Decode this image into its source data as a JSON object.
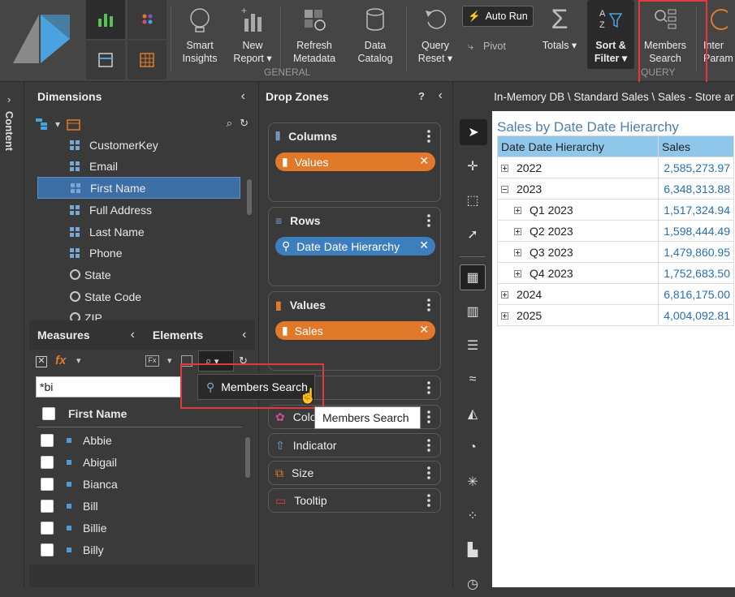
{
  "ribbon": {
    "buttons": [
      {
        "label": "Smart Insights",
        "line1": "Smart",
        "line2": "Insights"
      },
      {
        "label": "New Report",
        "line1": "New",
        "line2": "Report ▾"
      },
      {
        "label": "Refresh Metadata",
        "line1": "Refresh",
        "line2": "Metadata"
      },
      {
        "label": "Data Catalog",
        "line1": "Data",
        "line2": "Catalog"
      },
      {
        "label": "Query Reset",
        "line1": "Query",
        "line2": "Reset ▾"
      },
      {
        "label": "Auto Run"
      },
      {
        "label": "Pivot"
      },
      {
        "label": "Totals ▾"
      },
      {
        "label": "Sort & Filter",
        "line1": "Sort &",
        "line2": "Filter ▾"
      },
      {
        "label": "Members Search",
        "line1": "Members",
        "line2": "Search"
      },
      {
        "label": "Inter Param",
        "line1": "Inter",
        "line2": "Param"
      }
    ],
    "group_general": "GENERAL",
    "group_query": "QUERY"
  },
  "side_tab": "Content",
  "dimensions": {
    "title": "Dimensions",
    "items": [
      {
        "label": "CustomerKey",
        "icon": "grid-icon"
      },
      {
        "label": "Email",
        "icon": "grid-icon"
      },
      {
        "label": "First Name",
        "icon": "grid-icon",
        "selected": true
      },
      {
        "label": "Full Address",
        "icon": "grid-icon"
      },
      {
        "label": "Last Name",
        "icon": "grid-icon"
      },
      {
        "label": "Phone",
        "icon": "grid-icon"
      },
      {
        "label": "State",
        "icon": "globe-icon"
      },
      {
        "label": "State Code",
        "icon": "globe-icon"
      },
      {
        "label": "ZIP",
        "icon": "globe-icon"
      }
    ]
  },
  "bottom_tabs": {
    "measures": "Measures",
    "elements": "Elements"
  },
  "search": {
    "value": "*bi"
  },
  "members": {
    "header": "First Name",
    "items": [
      "Abbie",
      "Abigail",
      "Bianca",
      "Bill",
      "Billie",
      "Billy"
    ]
  },
  "popup": {
    "menu_item": "Members Search",
    "tooltip": "Members Search"
  },
  "drop_zones": {
    "title": "Drop Zones",
    "help": "?",
    "columns": {
      "label": "Columns",
      "pill": "Values"
    },
    "rows": {
      "label": "Rows",
      "pill": "Date Date Hierarchy"
    },
    "values": {
      "label": "Values",
      "pill": "Sales"
    },
    "extra": [
      {
        "label": "Color",
        "visible": "Colo"
      },
      {
        "label": "Indicator"
      },
      {
        "label": "Size"
      },
      {
        "label": "Tooltip"
      }
    ]
  },
  "breadcrumb": "In-Memory DB \\ Standard Sales \\ Sales - Store ar",
  "report": {
    "title": "Sales by Date Date Hierarchy",
    "col_headers": [
      "Date Date Hierarchy",
      "Sales"
    ],
    "rows": [
      {
        "label": "2022",
        "value": "2,585,273.97",
        "level": 0,
        "expanded": false
      },
      {
        "label": "2023",
        "value": "6,348,313.88",
        "level": 0,
        "expanded": true
      },
      {
        "label": "Q1 2023",
        "value": "1,517,324.94",
        "level": 1,
        "expanded": false
      },
      {
        "label": "Q2 2023",
        "value": "1,598,444.49",
        "level": 1,
        "expanded": false
      },
      {
        "label": "Q3 2023",
        "value": "1,479,860.95",
        "level": 1,
        "expanded": false
      },
      {
        "label": "Q4 2023",
        "value": "1,752,683.50",
        "level": 1,
        "expanded": false
      },
      {
        "label": "2024",
        "value": "6,816,175.00",
        "level": 0,
        "expanded": false
      },
      {
        "label": "2025",
        "value": "4,004,092.81",
        "level": 0,
        "expanded": false
      }
    ]
  },
  "colors": {
    "accent_red": "#e0393e",
    "pill_orange": "#e07a2a",
    "pill_blue": "#3d7ebd",
    "header_blue": "#8fc7ea",
    "title_blue": "#2a6fb0"
  }
}
